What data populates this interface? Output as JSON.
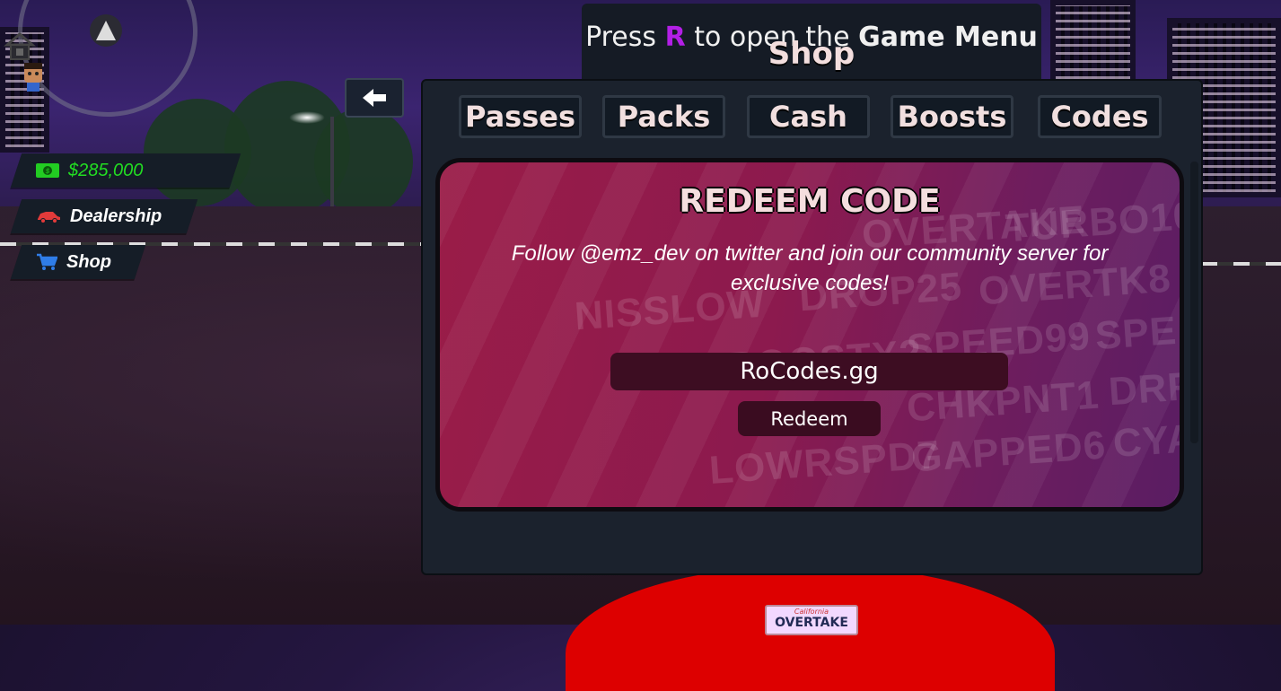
{
  "hint": {
    "prefix": "Press",
    "key": "R",
    "middle": "to open the",
    "bold": "Game Menu"
  },
  "shop": {
    "title": "Shop",
    "tabs": [
      "Passes",
      "Packs",
      "Cash",
      "Boosts",
      "Codes"
    ],
    "active_tab": "Codes"
  },
  "hud": {
    "cash": "$285,000",
    "dealership": "Dealership",
    "shop": "Shop"
  },
  "redeem": {
    "title": "REDEEM CODE",
    "description": "Follow @emz_dev on twitter and join our community server for exclusive codes!",
    "input_value": "RoCodes.gg",
    "button_label": "Redeem",
    "background_codes": [
      "OVERTAKE",
      "TURBO10",
      "NISSLOW",
      "DROP25",
      "OVERTK8",
      "BOOSTX2",
      "SPEED99",
      "SPE",
      "CHKPNT1",
      "DRF",
      "GAPPED6",
      "CYA",
      "LOWRSPD7"
    ]
  },
  "plate": {
    "state": "California",
    "text": "OVERTAKE"
  },
  "colors": {
    "accent_purple": "#b31fe6",
    "cash_green": "#22dd22",
    "panel": "#1b222d",
    "card_start": "#9a1c48",
    "card_end": "#5a1d63",
    "car_red": "#dd0000"
  }
}
